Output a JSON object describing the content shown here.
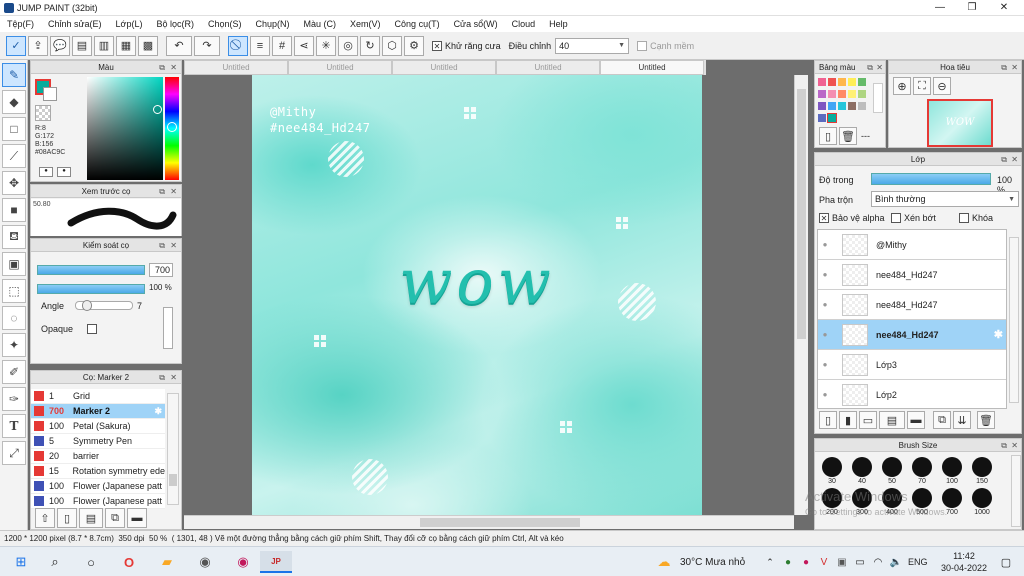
{
  "window": {
    "title": "JUMP PAINT (32bit)"
  },
  "menubar": {
    "items": [
      "Tệp(F)",
      "Chỉnh sửa(E)",
      "Lớp(L)",
      "Bộ lọc(R)",
      "Chọn(S)",
      "Chụp(N)",
      "Màu (C)",
      "Xem(V)",
      "Công cụ(T)",
      "Cửa sổ(W)",
      "Cloud",
      "Help"
    ]
  },
  "toolbar": {
    "antialias_label": "Khử răng cưa",
    "adjust_label": "Điều chỉnh",
    "adjust_value": "40",
    "edge_label": "Cạnh mềm"
  },
  "tabs": [
    "Untitled",
    "Untitled",
    "Untitled",
    "Untitled",
    "Untitled"
  ],
  "color_panel": {
    "title": "Màu",
    "r": "R:8",
    "g": "G:172",
    "b": "B:156",
    "hex": "#08AC9C",
    "fg_color": "#08ac9c"
  },
  "preview_panel": {
    "title": "Xem trước cọ",
    "size": "50.80"
  },
  "brush_control": {
    "title": "Kiểm soát cọ",
    "size_value": "700",
    "opacity_value": "100 %",
    "angle_label": "Angle",
    "angle_value": "7",
    "opaque_label": "Opaque"
  },
  "brush_list": {
    "title": "Cọ: Marker 2",
    "items": [
      {
        "size": "1",
        "name": "Grid",
        "color": "#e53935"
      },
      {
        "size": "700",
        "name": "Marker 2",
        "color": "#e53935",
        "active": true
      },
      {
        "size": "100",
        "name": "Petal (Sakura)",
        "color": "#e53935"
      },
      {
        "size": "5",
        "name": "Symmetry Pen",
        "color": "#3f51b5"
      },
      {
        "size": "20",
        "name": "barrier",
        "color": "#e53935"
      },
      {
        "size": "15",
        "name": "Rotation symmetry ede",
        "color": "#e53935"
      },
      {
        "size": "100",
        "name": "Flower (Japanese patt",
        "color": "#3f51b5"
      },
      {
        "size": "100",
        "name": "Flower (Japanese patt",
        "color": "#3f51b5"
      }
    ]
  },
  "canvas": {
    "tag1": "@Mithy",
    "tag2": "#nee484_Hd247",
    "headline": "wow"
  },
  "palette_panel": {
    "title": "Bảng màu",
    "more": "---"
  },
  "navigator_panel": {
    "title": "Hoa tiêu",
    "thumb_text": "WOW"
  },
  "layers_panel": {
    "title": "Lớp",
    "opacity_label": "Độ trong",
    "opacity_value": "100 %",
    "blend_label": "Pha trộn",
    "blend_value": "Bình thường",
    "protect_alpha": "Bảo vệ alpha",
    "clip": "Xén bớt",
    "lock": "Khóa",
    "layers": [
      {
        "name": "@Mithy"
      },
      {
        "name": "nee484_Hd247"
      },
      {
        "name": "nee484_Hd247"
      },
      {
        "name": "nee484_Hd247",
        "active": true
      },
      {
        "name": "Lớp3"
      },
      {
        "name": "Lớp2"
      }
    ]
  },
  "brush_size_panel": {
    "title": "Brush Size",
    "sizes": [
      "30",
      "40",
      "50",
      "70",
      "100",
      "150",
      "200",
      "300",
      "400",
      "500",
      "700",
      "1000"
    ]
  },
  "watermark": {
    "line1": "Activate Windows",
    "line2": "Go to Settings to activate Windows."
  },
  "statusbar": {
    "dims": "1200 * 1200 pixel",
    "cm": "(8.7 * 8.7cm)",
    "dpi": "350 dpi",
    "zoom": "50 %",
    "coords": "( 1301, 48 )",
    "hint": "Vẽ một đường thẳng bằng cách giữ phím Shift, Thay đổi cỡ cọ bằng cách giữ phím Ctrl, Alt và kéo"
  },
  "taskbar": {
    "weather": "30°C  Mưa nhỏ",
    "lang": "ENG",
    "time": "11:42",
    "date": "30-04-2022"
  }
}
